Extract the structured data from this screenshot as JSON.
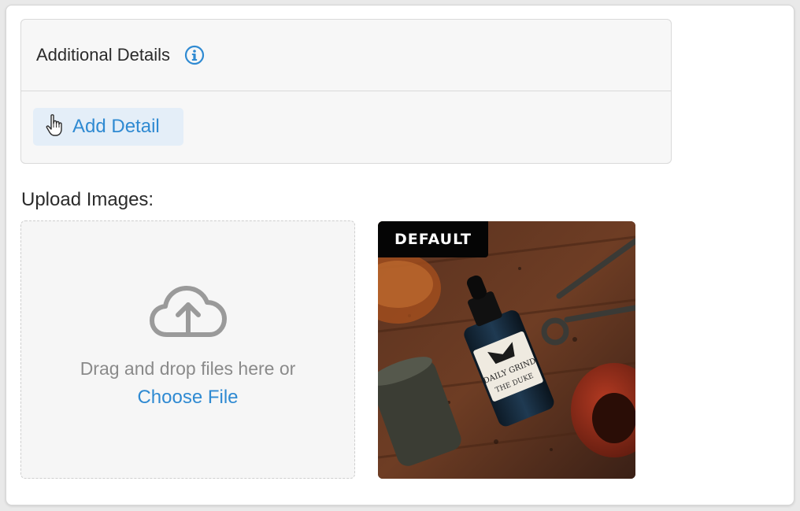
{
  "details": {
    "title": "Additional Details",
    "info_icon": "info-circle-icon",
    "add_button_label": "Add Detail",
    "add_button_icon": "hand-pointer-icon"
  },
  "upload": {
    "label": "Upload Images:",
    "dropzone_icon": "cloud-upload-icon",
    "drop_text": "Drag and drop files here or",
    "choose_file_label": "Choose File"
  },
  "images": [
    {
      "badge": "DEFAULT",
      "bottle_label_lines": [
        "DAILY GRIND",
        "THE DUKE"
      ]
    }
  ],
  "colors": {
    "accent": "#2f8ad2",
    "panel_bg": "#f7f7f7",
    "button_bg": "#e4eef8",
    "muted_text": "#8a8a8a",
    "icon_gray": "#9a9a9a",
    "badge_bg": "#050505"
  }
}
